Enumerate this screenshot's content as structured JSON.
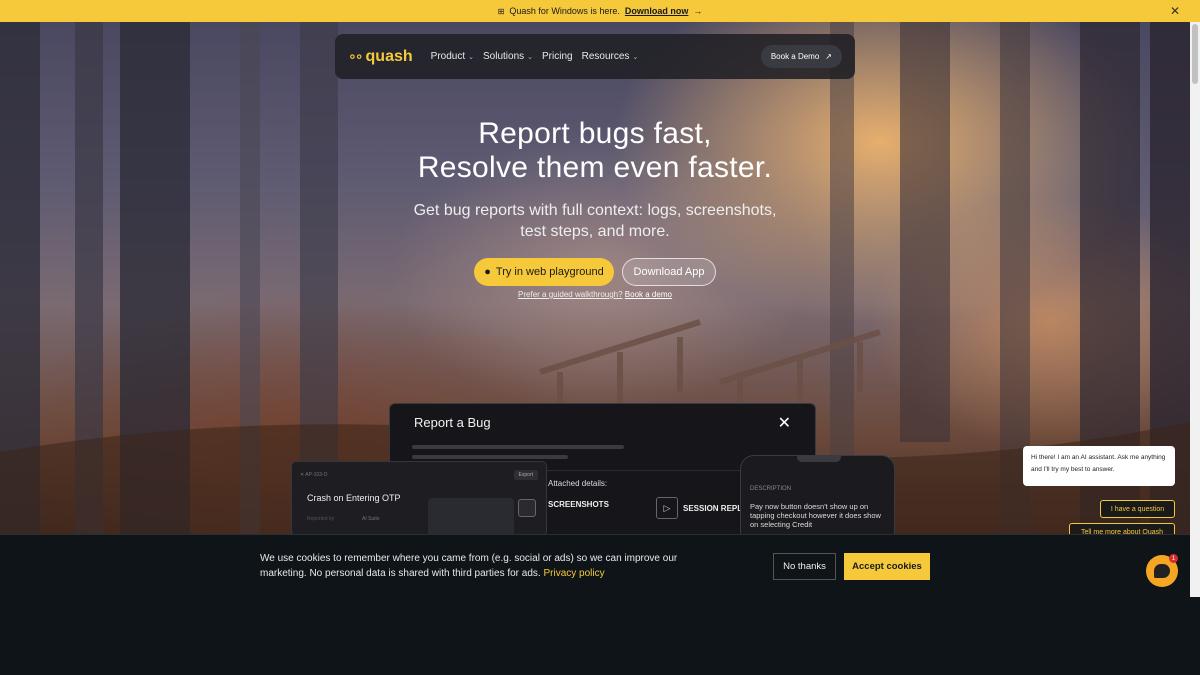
{
  "announcement": {
    "icon": "windows-icon",
    "text": "Quash for Windows is here.",
    "link": "Download now",
    "arrow": "→",
    "close": "✕"
  },
  "nav": {
    "logo": "quash",
    "items": [
      {
        "label": "Product",
        "dropdown": true
      },
      {
        "label": "Solutions",
        "dropdown": true
      },
      {
        "label": "Pricing",
        "dropdown": false
      },
      {
        "label": "Resources",
        "dropdown": true
      }
    ],
    "cta": "Book a Demo",
    "cta_icon": "↗"
  },
  "hero": {
    "title_line1": "Report bugs fast,",
    "title_line2": "Resolve them even faster.",
    "subtitle_line1": "Get bug reports with full context: logs, screenshots,",
    "subtitle_line2": "test steps, and more.",
    "primary_button": "Try in web playground",
    "secondary_button": "Download App",
    "prefer_text": "Prefer a guided walkthrough?",
    "prefer_link": "Book a demo"
  },
  "modal": {
    "title": "Report a Bug",
    "close": "✕",
    "attached": "Attached details:",
    "screenshots": "SCREENSHOTS",
    "session": "SESSION REPL"
  },
  "card_left": {
    "top": "✕  AP-103-O",
    "export": "Export",
    "title": "Crash on Entering OTP",
    "meta_label": "Reported by",
    "meta_value": "AI Suite"
  },
  "phone_right": {
    "label": "DESCRIPTION",
    "description": "Pay now button doesn't show up on tapping checkout however it does show on selecting Credit"
  },
  "chat": {
    "bubble": "Hi there! I am an AI assistant. Ask me anything and I'll try my best to answer.",
    "question": "I have a question",
    "tell": "Tell me more about Quash",
    "badge": "1"
  },
  "cookie": {
    "text": "We use cookies to remember where you came from (e.g. social or ads) so we can improve our marketing. No personal data is shared with third parties for ads.",
    "policy": "Privacy policy",
    "decline": "No thanks",
    "accept": "Accept cookies"
  },
  "colors": {
    "accent": "#f5c93a",
    "banner_bg": "#0f1419",
    "nav_bg": "#202026"
  }
}
